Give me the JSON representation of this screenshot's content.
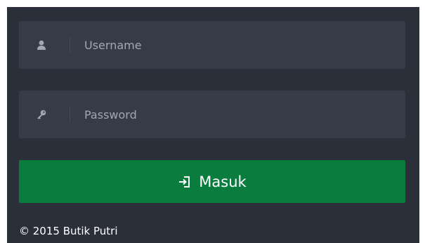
{
  "login": {
    "username_placeholder": "Username",
    "username_value": "",
    "password_placeholder": "Password",
    "password_value": "",
    "submit_label": "Masuk"
  },
  "icons": {
    "username": "user-icon",
    "password": "key-icon",
    "submit": "sign-in-icon"
  },
  "footer": {
    "copyright": "© 2015 Butik Putri"
  },
  "colors": {
    "panel_bg": "#2b2f3a",
    "field_bg": "#363b47",
    "button_bg": "#0a7d3e",
    "text": "#ffffff"
  }
}
